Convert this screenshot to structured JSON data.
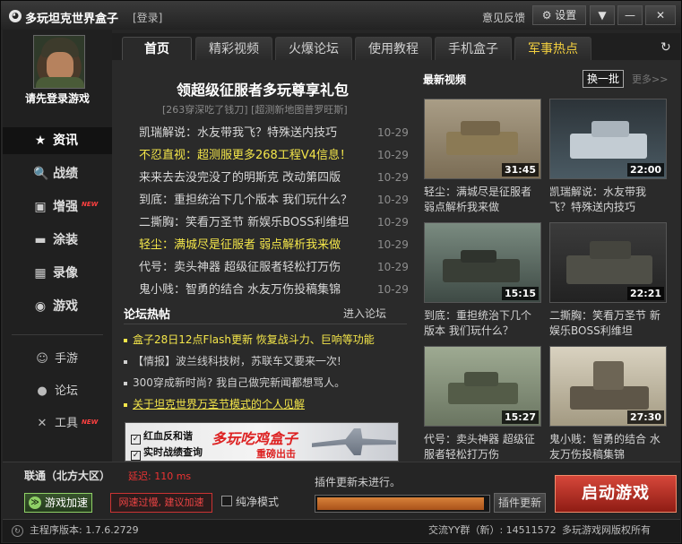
{
  "titlebar": {
    "logo_glyph": "◕",
    "title": "多玩坦克世界盒子",
    "login_link": "[登录]",
    "feedback": "意见反馈",
    "settings_label": "⚙ 设置",
    "dropdown_glyph": "▼",
    "minimize_glyph": "—",
    "close_glyph": "✕"
  },
  "sidebar": {
    "login_prompt": "请先登录游戏",
    "nav": [
      {
        "label": "资讯",
        "icon": "★",
        "icon_name": "star-icon",
        "active": true
      },
      {
        "label": "战绩",
        "icon": "🔍",
        "icon_name": "search-icon"
      },
      {
        "label": "增强",
        "icon": "▣",
        "icon_name": "toolbox-icon",
        "badge": "NEW"
      },
      {
        "label": "涂装",
        "icon": "▬",
        "icon_name": "tank-icon"
      },
      {
        "label": "录像",
        "icon": "▦",
        "icon_name": "film-icon"
      },
      {
        "label": "游戏",
        "icon": "◉",
        "icon_name": "gamepad-icon"
      }
    ],
    "sub": [
      {
        "label": "手游",
        "icon": "☺",
        "icon_name": "robot-icon"
      },
      {
        "label": "论坛",
        "icon": "●",
        "icon_name": "chat-bubble-icon"
      },
      {
        "label": "工具",
        "icon": "✕",
        "icon_name": "tools-icon",
        "badge": "NEW"
      }
    ]
  },
  "tabs": [
    {
      "label": "首页",
      "active": true
    },
    {
      "label": "精彩视频"
    },
    {
      "label": "火爆论坛"
    },
    {
      "label": "使用教程"
    },
    {
      "label": "手机盒子"
    },
    {
      "label": "军事热点",
      "hot": true
    }
  ],
  "refresh_glyph": "↻",
  "news": {
    "headline": "领超级征服者多玩尊享礼包",
    "sub_links": "[263穿深吃了钱刀]  [超测新地图普罗旺斯]",
    "items": [
      {
        "title": "凯瑞解说：水友带我飞？特殊送内技巧",
        "date": "10-29"
      },
      {
        "title": "不忍直视：超测服更多268工程V4信息！",
        "date": "10-29",
        "highlight": true
      },
      {
        "title": "来来去去没完没了的明斯克 改动第四版",
        "date": "10-29"
      },
      {
        "title": "到底：重担统治下几个版本 我们玩什么？",
        "date": "10-29"
      },
      {
        "title": "二撕胸：笑看万圣节 新娱乐BOSS利维坦",
        "date": "10-29"
      },
      {
        "title": "轻尘：满城尽是征服者 弱点解析我来做",
        "date": "10-29",
        "highlight": true
      },
      {
        "title": "代号：卖头神器 超级征服者轻松打万伤",
        "date": "10-29"
      },
      {
        "title": "鬼小贱：智勇的结合 水友万伤投稿集锦",
        "date": "10-29"
      }
    ]
  },
  "forum": {
    "title": "论坛热帖",
    "more": "进入论坛",
    "items": [
      {
        "text": "盒子28日12点Flash更新 恢复战斗力、巨响等功能",
        "style": "yellow"
      },
      {
        "text": "【情报】波兰线科技树，苏联车又要来一次!",
        "style": "normal"
      },
      {
        "text": "300穿成新时尚? 我自己做完新闻都想骂人。",
        "style": "normal"
      },
      {
        "text": "关于坦克世界万圣节模式的个人见解",
        "style": "link"
      }
    ]
  },
  "ad": {
    "line1": "红血反和谐",
    "line2": "实时战绩查询",
    "check": "✓",
    "title": "多玩吃鸡盒子",
    "subtitle": "重磅出击"
  },
  "videos": {
    "title": "最新视频",
    "swap_label": "换一批",
    "more": "更多>>",
    "items": [
      {
        "duration": "31:45",
        "caption": "轻尘：满城尽是征服者 弱点解析我来做"
      },
      {
        "duration": "22:00",
        "caption": "凯瑞解说：水友带我飞？特殊送内技巧"
      },
      {
        "duration": "15:15",
        "caption": "到底：重担统治下几个版本 我们玩什么？"
      },
      {
        "duration": "22:21",
        "caption": "二撕胸：笑看万圣节 新娱乐BOSS利维坦"
      },
      {
        "duration": "15:27",
        "caption": "代号：卖头神器 超级征服者轻松打万伤"
      },
      {
        "duration": "27:30",
        "caption": "鬼小贱：智勇的结合 水友万伤投稿集锦"
      }
    ]
  },
  "bottom": {
    "server": "联通（北方大区）",
    "latency": "延迟: 110 ms",
    "accel_label": "游戏加速",
    "accel_icon": "≫",
    "warning": "网速过慢, 建议加速",
    "pure_mode": "纯净模式",
    "plugin_status": "插件更新未进行。",
    "progress": 0.98,
    "plugin_button": "插件更新",
    "launch_button": "启动游戏"
  },
  "statusbar": {
    "version_icon": "↻",
    "version": "主程序版本: 1.7.6.2729",
    "qq_group": "交流YY群（新）: 14511572",
    "rights": "多玩游戏网版权所有"
  }
}
